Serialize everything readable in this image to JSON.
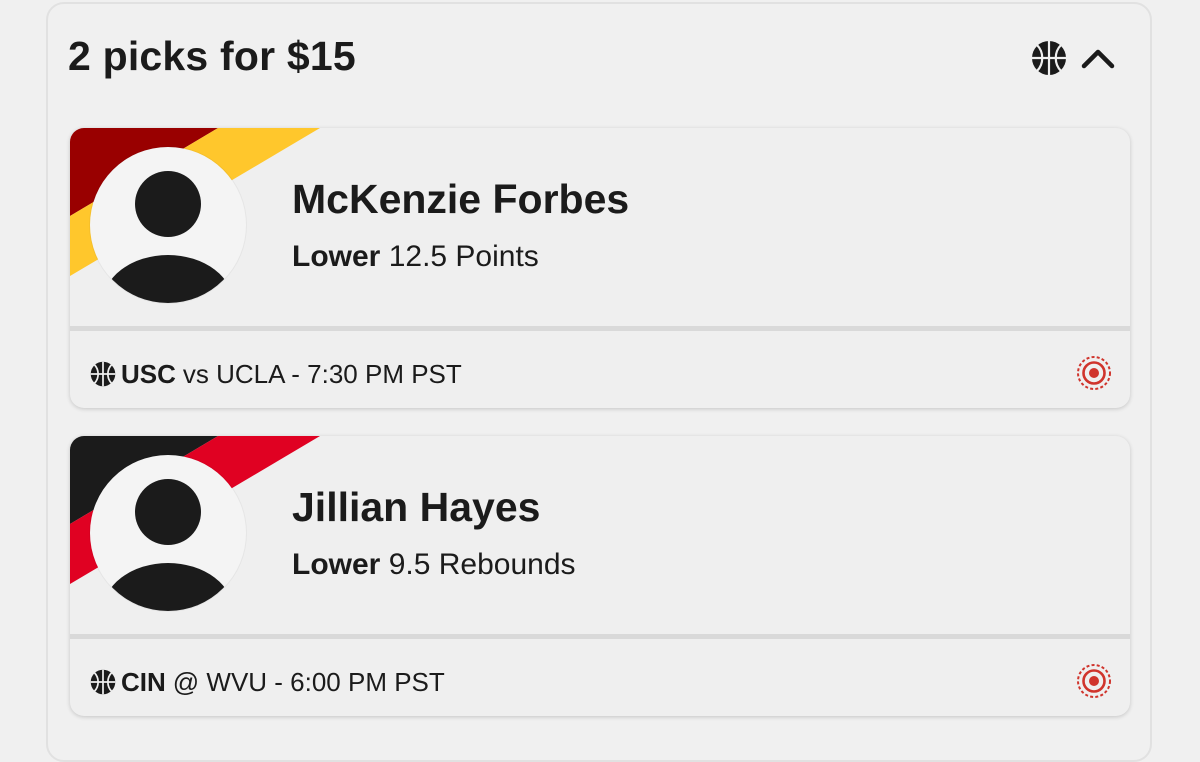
{
  "header": {
    "title": "2 picks for $15",
    "sport_icon": "basketball-icon",
    "collapse_icon": "chevron-up-icon"
  },
  "picks": [
    {
      "player_name": "McKenzie Forbes",
      "direction": "Lower",
      "stat_line": "12.5 Points",
      "team_colors": [
        "#990000",
        "#FFC72C"
      ],
      "game": {
        "team": "USC",
        "matchup": "vs UCLA - 7:30 PM PST"
      },
      "status_icon": "target-icon"
    },
    {
      "player_name": "Jillian Hayes",
      "direction": "Lower",
      "stat_line": "9.5 Rebounds",
      "team_colors": [
        "#1b1b1b",
        "#E00122"
      ],
      "game": {
        "team": "CIN",
        "matchup": "@ WVU - 6:00 PM PST"
      },
      "status_icon": "target-icon"
    }
  ],
  "colors": {
    "text": "#1b1b1b",
    "accent_red": "#d0342c",
    "background": "#f0f0f0"
  }
}
